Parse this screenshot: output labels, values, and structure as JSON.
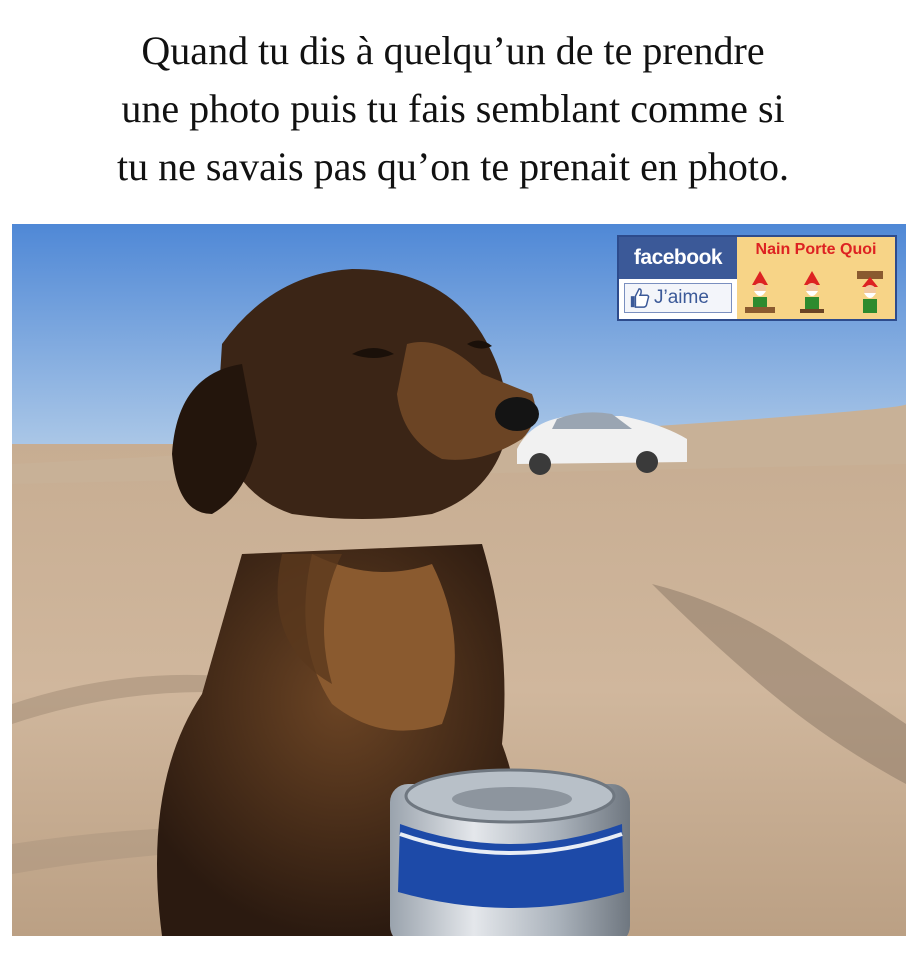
{
  "caption": {
    "lines": [
      "Quand tu dis à quelqu’un de te prendre",
      "une photo puis tu fais semblant comme si",
      "tu ne savais pas qu’on te prenait en photo."
    ]
  },
  "photo": {
    "subject": "dog-with-can-on-beach"
  },
  "badge": {
    "brand": "facebook",
    "like_label": "J’aime",
    "page_name": "Nain Porte Quoi",
    "colors": {
      "facebook_blue": "#3b5998",
      "page_bg": "#f7d487",
      "page_name": "#dd2222"
    }
  }
}
